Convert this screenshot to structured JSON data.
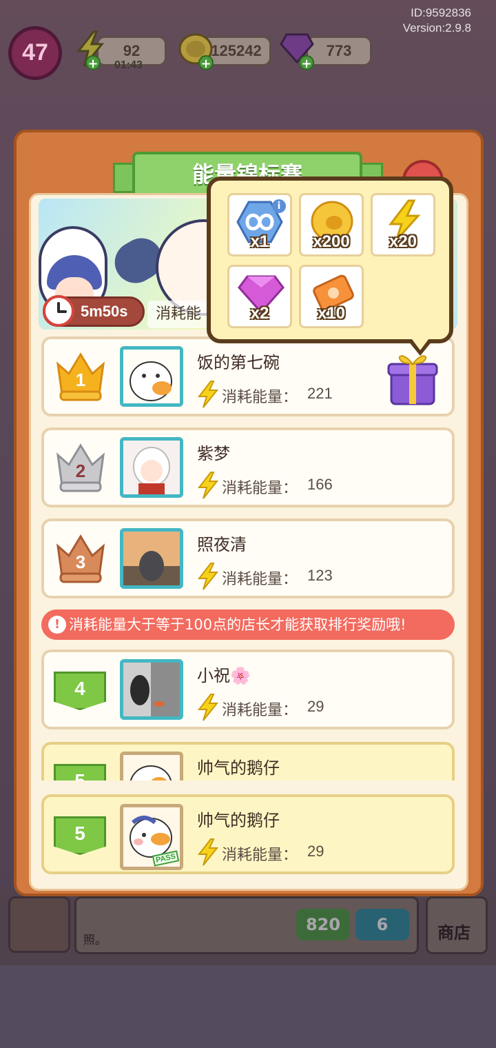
{
  "hud": {
    "level": "47",
    "energy": "92",
    "energy_timer": "01:43",
    "coins": "125242",
    "gems": "773",
    "id": "ID:9592836",
    "version": "Version:2.9.8"
  },
  "panel": {
    "title": "能量锦标赛",
    "timer": "5m50s",
    "banner_cost_label": "消耗能"
  },
  "reward_popup": {
    "items": [
      {
        "icon": "infinity-icon",
        "qty": "x1"
      },
      {
        "icon": "coin-icon",
        "qty": "x200"
      },
      {
        "icon": "energy-icon",
        "qty": "x20"
      },
      {
        "icon": "gem-icon",
        "qty": "x2"
      },
      {
        "icon": "ticket-icon",
        "qty": "x10"
      }
    ]
  },
  "leaderboard": {
    "energy_label": "消耗能量：",
    "rows": [
      {
        "rank": "1",
        "name": "饭的第七碗",
        "energy": "221"
      },
      {
        "rank": "2",
        "name": "紫梦",
        "energy": "166"
      },
      {
        "rank": "3",
        "name": "照夜清",
        "energy": "123"
      },
      {
        "rank": "4",
        "name": "小祝🌸",
        "energy": "29"
      },
      {
        "rank": "5",
        "name": "帅气的鹅仔",
        "energy": "29"
      }
    ],
    "notice": "消耗能量大于等于100点的店长才能获取排行奖励哦!",
    "me": {
      "rank": "5",
      "name": "帅气的鹅仔",
      "energy": "29",
      "badge": "PASS"
    }
  },
  "background": {
    "tile_a": "820",
    "tile_b": "6",
    "shop": "商店",
    "text": "照。"
  }
}
